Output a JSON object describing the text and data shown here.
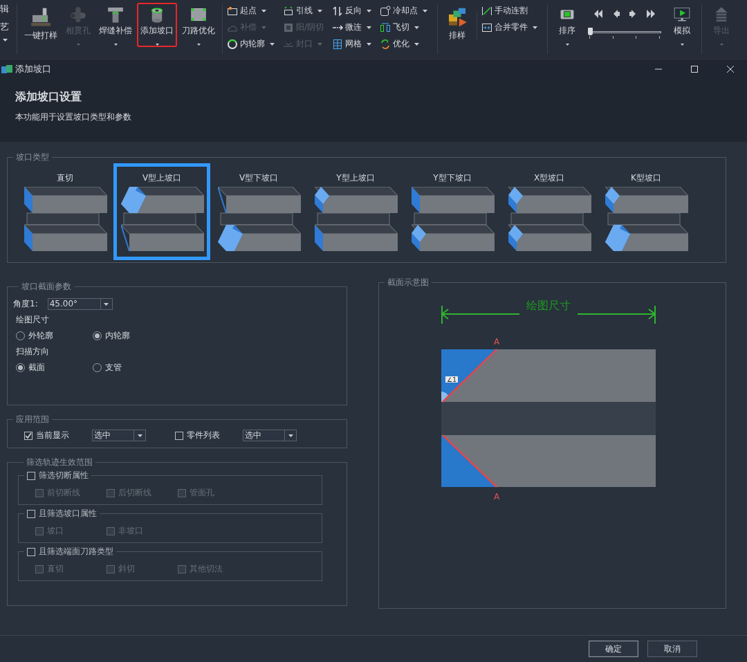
{
  "ribbon": {
    "partial_labels": [
      "辑",
      "艺"
    ],
    "large_buttons": [
      {
        "label": "一键打样",
        "kind": "machine",
        "disabled": false,
        "dropdown": false,
        "selected": false
      },
      {
        "label": "相贯孔",
        "kind": "pipe",
        "disabled": true,
        "dropdown": true,
        "selected": false
      },
      {
        "label": "焊缝补偿",
        "kind": "tee",
        "disabled": false,
        "dropdown": true,
        "selected": false
      },
      {
        "label": "添加坡口",
        "kind": "cylinder",
        "disabled": false,
        "dropdown": true,
        "selected": true
      },
      {
        "label": "刀路优化",
        "kind": "frame",
        "disabled": false,
        "dropdown": true,
        "selected": false
      }
    ],
    "small_columns": [
      [
        {
          "label": "起点",
          "kind": "start",
          "disabled": false,
          "dropdown": true
        },
        {
          "label": "补偿",
          "kind": "cloud",
          "disabled": true,
          "dropdown": true
        },
        {
          "label": "内轮廓",
          "kind": "ring",
          "disabled": false,
          "dropdown": true
        }
      ],
      [
        {
          "label": "引线",
          "kind": "lead",
          "disabled": false,
          "dropdown": true
        },
        {
          "label": "阳/阴切",
          "kind": "square",
          "disabled": true,
          "dropdown": false
        },
        {
          "label": "封口",
          "kind": "seal",
          "disabled": true,
          "dropdown": true
        }
      ],
      [
        {
          "label": "反向",
          "kind": "reverse",
          "disabled": false,
          "dropdown": true
        },
        {
          "label": "微连",
          "kind": "microjoint",
          "disabled": false,
          "dropdown": true
        },
        {
          "label": "网格",
          "kind": "grid",
          "disabled": false,
          "dropdown": true
        }
      ],
      [
        {
          "label": "冷却点",
          "kind": "cooling",
          "disabled": false,
          "dropdown": true
        },
        {
          "label": "飞切",
          "kind": "flycut",
          "disabled": false,
          "dropdown": true
        },
        {
          "label": "优化",
          "kind": "cycle",
          "disabled": false,
          "dropdown": true
        }
      ]
    ],
    "nest_button": {
      "label": "排样",
      "kind": "blocks",
      "disabled": false,
      "dropdown": false,
      "selected": false
    },
    "nest_column": [
      {
        "label": "手动连割",
        "kind": "diagonal",
        "disabled": false,
        "dropdown": false
      },
      {
        "label": "合并零件",
        "kind": "merge",
        "disabled": false,
        "dropdown": true
      }
    ],
    "sort_button": {
      "label": "排序",
      "kind": "plate",
      "disabled": false,
      "dropdown": true,
      "selected": false
    },
    "playback": {
      "level": 0
    },
    "simulate_button": {
      "label": "模拟",
      "kind": "monitor",
      "disabled": false,
      "dropdown": true,
      "selected": false
    },
    "export_button": {
      "label": "导出",
      "kind": "upload",
      "disabled": true,
      "dropdown": true,
      "selected": false
    }
  },
  "dialog": {
    "title": "添加坡口",
    "heading": "添加坡口设置",
    "description": "本功能用于设置坡口类型和参数",
    "groove_types": {
      "title": "坡口类型",
      "items": [
        {
          "label": "直切",
          "kind": "straight",
          "selected": false
        },
        {
          "label": "V型上坡口",
          "kind": "v-top",
          "selected": true
        },
        {
          "label": "V型下坡口",
          "kind": "v-bottom",
          "selected": false
        },
        {
          "label": "Y型上坡口",
          "kind": "y-top",
          "selected": false
        },
        {
          "label": "Y型下坡口",
          "kind": "y-bottom",
          "selected": false
        },
        {
          "label": "X型坡口",
          "kind": "x",
          "selected": false
        },
        {
          "label": "K型坡口",
          "kind": "k",
          "selected": false
        }
      ]
    },
    "section_params": {
      "title": "坡口截面参数",
      "angle": {
        "label": "角度1:",
        "value": "45.00°"
      },
      "drawing_size": {
        "label": "绘图尺寸",
        "options": [
          {
            "label": "外轮廓",
            "selected": false
          },
          {
            "label": "内轮廓",
            "selected": true
          }
        ]
      },
      "scan_direction": {
        "label": "扫描方向",
        "options": [
          {
            "label": "截面",
            "selected": true
          },
          {
            "label": "支管",
            "selected": false
          }
        ]
      }
    },
    "apply_range": {
      "title": "应用范围",
      "items": [
        {
          "label": "当前显示",
          "checked": true,
          "value": "选中"
        },
        {
          "label": "零件列表",
          "checked": false,
          "value": "选中"
        }
      ]
    },
    "filter": {
      "title": "筛选轨迹生效范围",
      "groups": [
        {
          "label": "筛选切断属性",
          "checked": false,
          "options": [
            {
              "label": "前切断线",
              "checked": false,
              "disabled": true
            },
            {
              "label": "后切断线",
              "checked": false,
              "disabled": true
            },
            {
              "label": "管面孔",
              "checked": false,
              "disabled": true
            }
          ]
        },
        {
          "label": "且筛选坡口属性",
          "checked": false,
          "options": [
            {
              "label": "坡口",
              "checked": false,
              "disabled": true
            },
            {
              "label": "非坡口",
              "checked": false,
              "disabled": true
            }
          ]
        },
        {
          "label": "且筛选端面刀路类型",
          "checked": false,
          "options": [
            {
              "label": "直切",
              "checked": false,
              "disabled": true
            },
            {
              "label": "斜切",
              "checked": false,
              "disabled": true
            },
            {
              "label": "其他切法",
              "checked": false,
              "disabled": true
            }
          ]
        }
      ]
    },
    "preview": {
      "title": "截面示意图",
      "dimension_label": "绘图尺寸",
      "top_marker": "A",
      "bottom_marker": "A",
      "angle_label": "∠1"
    },
    "buttons": [
      {
        "label": "确定",
        "default": true
      },
      {
        "label": "取消",
        "default": false
      }
    ]
  }
}
